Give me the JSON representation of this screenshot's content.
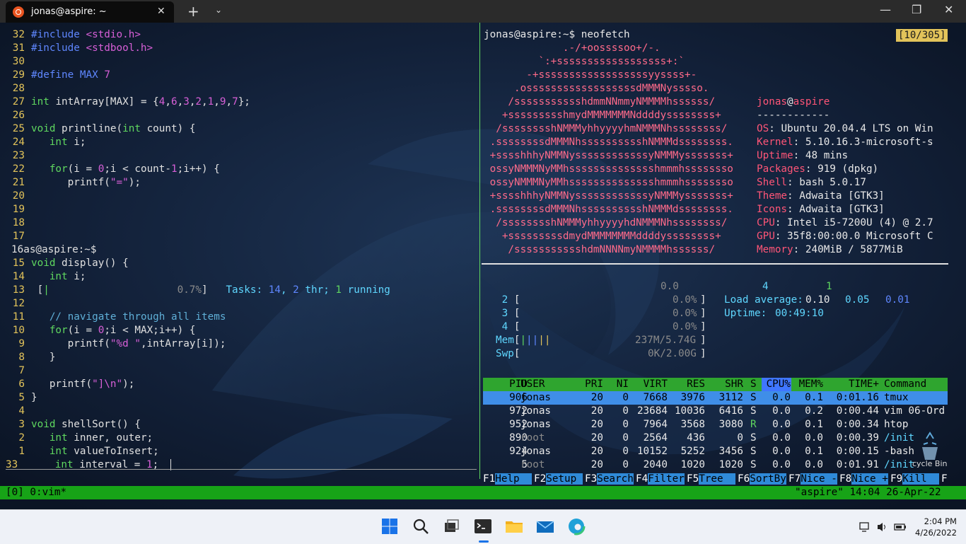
{
  "window": {
    "tab_title": "jonas@aspire: ~",
    "tab_close": "✕",
    "new_tab": "+",
    "dropdown": "⌄",
    "minimize": "—",
    "maximize": "❐",
    "close": "✕"
  },
  "vim": {
    "lines": [
      {
        "ln": "32",
        "parts": [
          [
            "pp",
            "#include "
          ],
          [
            "str",
            "<stdio.h>"
          ]
        ]
      },
      {
        "ln": "31",
        "parts": [
          [
            "pp",
            "#include "
          ],
          [
            "str",
            "<stdbool.h>"
          ]
        ]
      },
      {
        "ln": "30",
        "parts": []
      },
      {
        "ln": "29",
        "parts": [
          [
            "pp",
            "#define "
          ],
          [
            "pp",
            "MAX "
          ],
          [
            "num",
            "7"
          ]
        ]
      },
      {
        "ln": "28",
        "parts": []
      },
      {
        "ln": "27",
        "parts": [
          [
            "kw",
            "int "
          ],
          [
            "tx",
            "intArray[MAX] = {"
          ],
          [
            "num",
            "4"
          ],
          [
            "tx",
            ","
          ],
          [
            "num",
            "6"
          ],
          [
            "tx",
            ","
          ],
          [
            "num",
            "3"
          ],
          [
            "tx",
            ","
          ],
          [
            "num",
            "2"
          ],
          [
            "tx",
            ","
          ],
          [
            "num",
            "1"
          ],
          [
            "tx",
            ","
          ],
          [
            "num",
            "9"
          ],
          [
            "tx",
            ","
          ],
          [
            "num",
            "7"
          ],
          [
            "tx",
            "};"
          ]
        ]
      },
      {
        "ln": "26",
        "parts": []
      },
      {
        "ln": "25",
        "parts": [
          [
            "kw",
            "void "
          ],
          [
            "tx",
            "printline("
          ],
          [
            "kw",
            "int "
          ],
          [
            "tx",
            "count) {"
          ]
        ]
      },
      {
        "ln": "24",
        "parts": [
          [
            "tx",
            "   "
          ],
          [
            "kw",
            "int "
          ],
          [
            "tx",
            "i;"
          ]
        ]
      },
      {
        "ln": "23",
        "parts": []
      },
      {
        "ln": "22",
        "parts": [
          [
            "tx",
            "   "
          ],
          [
            "kw",
            "for"
          ],
          [
            "tx",
            "(i = "
          ],
          [
            "num",
            "0"
          ],
          [
            "tx",
            ";i < count-"
          ],
          [
            "num",
            "1"
          ],
          [
            "tx",
            ";i++) {"
          ]
        ]
      },
      {
        "ln": "21",
        "parts": [
          [
            "tx",
            "      printf("
          ],
          [
            "str",
            "\"=\""
          ],
          [
            "tx",
            ");"
          ]
        ]
      },
      {
        "ln": "20",
        "parts": []
      },
      {
        "ln": "19",
        "parts": []
      },
      {
        "ln": "18",
        "parts": []
      },
      {
        "ln": "17",
        "parts": []
      },
      {
        "ln": "16",
        "raw": "16as@aspire:~$",
        "parts": []
      },
      {
        "ln": "15",
        "parts": [
          [
            "kw",
            "void "
          ],
          [
            "tx",
            "display() {"
          ]
        ]
      },
      {
        "ln": "14",
        "parts": [
          [
            "tx",
            "   "
          ],
          [
            "kw",
            "int "
          ],
          [
            "tx",
            "i;"
          ]
        ]
      },
      {
        "ln": "13",
        "parts": [
          [
            "tx",
            " ["
          ],
          [
            "gr",
            "|"
          ],
          [
            "gy",
            "                     0.7%"
          ],
          [
            "tx",
            "]   "
          ],
          [
            "cy",
            "Tasks: "
          ],
          [
            "bl",
            "14"
          ],
          [
            "cy",
            ", "
          ],
          [
            "bl",
            "2 "
          ],
          [
            "cy",
            "thr; "
          ],
          [
            "gr",
            "1 "
          ],
          [
            "cy",
            "running"
          ]
        ]
      },
      {
        "ln": "12",
        "parts": []
      },
      {
        "ln": "11",
        "parts": [
          [
            "tx",
            "   "
          ],
          [
            "cm",
            "// navigate through all items"
          ]
        ]
      },
      {
        "ln": "10",
        "parts": [
          [
            "tx",
            "   "
          ],
          [
            "kw",
            "for"
          ],
          [
            "tx",
            "(i = "
          ],
          [
            "num",
            "0"
          ],
          [
            "tx",
            ";i < MAX;i++) {"
          ]
        ]
      },
      {
        "ln": "9",
        "parts": [
          [
            "tx",
            "      printf("
          ],
          [
            "str",
            "\"%d \""
          ],
          [
            "tx",
            ",intArray[i]);"
          ]
        ]
      },
      {
        "ln": "8",
        "parts": [
          [
            "tx",
            "   }"
          ]
        ]
      },
      {
        "ln": "7",
        "parts": []
      },
      {
        "ln": "6",
        "parts": [
          [
            "tx",
            "   printf("
          ],
          [
            "str",
            "\"]\\n\""
          ],
          [
            "tx",
            ");"
          ]
        ]
      },
      {
        "ln": "5",
        "parts": [
          [
            "tx",
            "}"
          ]
        ]
      },
      {
        "ln": "4",
        "parts": []
      },
      {
        "ln": "3",
        "parts": [
          [
            "kw",
            "void "
          ],
          [
            "tx",
            "shellSort() {"
          ]
        ]
      },
      {
        "ln": "2",
        "parts": [
          [
            "tx",
            "   "
          ],
          [
            "kw",
            "int "
          ],
          [
            "tx",
            "inner, outer;"
          ]
        ]
      },
      {
        "ln": "1",
        "parts": [
          [
            "tx",
            "   "
          ],
          [
            "kw",
            "int "
          ],
          [
            "tx",
            "valueToInsert;"
          ]
        ]
      },
      {
        "ln": "33",
        "cur": true,
        "parts": [
          [
            "tx",
            "   "
          ],
          [
            "kw",
            "int "
          ],
          [
            "tx",
            "interval = "
          ],
          [
            "num",
            "1"
          ],
          [
            "tx",
            ";  "
          ]
        ]
      }
    ]
  },
  "neofetch": {
    "prompt": "jonas@aspire:~$ neofetch",
    "counter": "[10/305]",
    "logo": [
      "             .-/+oossssoo+/-.",
      "         `:+ssssssssssssssssss+:`",
      "       -+ssssssssssssssssssyyssss+-",
      "     .ossssssssssssssssssdMMMNysssso.",
      "    /ssssssssssshdmmNNmmyNMMMMhssssss/",
      "   +ssssssssshmydMMMMMMMNddddyssssssss+",
      "  /sssssssshNMMMyhhyyyyhmNMMMNhssssssss/",
      " .ssssssssdMMMNhsssssssssshNMMMdssssssss.",
      " +sssshhhyNMMNyssssssssssssyNMMMysssssss+",
      " ossyNMMMNyMMhsssssssssssssshmmmhssssssso",
      " ossyNMMMNyMMhsssssssssssssshmmmhssssssso",
      " +sssshhhyNMMNyssssssssssssyNMMMysssssss+",
      " .ssssssssdMMMNhsssssssssshNMMMdssssssss.",
      "  /sssssssshNMMMyhhyyyyhdNMMMNhssssssss/",
      "   +sssssssssdmydMMMMMMMMddddyssssssss+",
      "    /ssssssssssshdmNNNNmyNMMMMhssssss/"
    ],
    "user": "jonas",
    "at": "@",
    "host": "aspire",
    "sep": "------------",
    "info": [
      {
        "key": "OS",
        "value": "Ubuntu 20.04.4 LTS on Win"
      },
      {
        "key": "Kernel",
        "value": "5.10.16.3-microsoft-s"
      },
      {
        "key": "Uptime",
        "value": "48 mins"
      },
      {
        "key": "Packages",
        "value": "919 (dpkg)"
      },
      {
        "key": "Shell",
        "value": "bash 5.0.17"
      },
      {
        "key": "Theme",
        "value": "Adwaita [GTK3]"
      },
      {
        "key": "Icons",
        "value": "Adwaita [GTK3]"
      },
      {
        "key": "CPU",
        "value": "Intel i5-7200U (4) @ 2.7"
      },
      {
        "key": "GPU",
        "value": "35f8:00:00.0 Microsoft C"
      },
      {
        "key": "Memory",
        "value": "240MiB / 5877MiB"
      }
    ]
  },
  "htop": {
    "top_line": {
      "val": "0.0",
      "n1": "4",
      "n2": "1"
    },
    "cpus": [
      {
        "n": "2",
        "pct": "0.0%"
      },
      {
        "n": "3",
        "pct": "0.0%"
      },
      {
        "n": "4",
        "pct": "0.0%"
      }
    ],
    "load_label": "Load average: ",
    "load": [
      "0.10",
      "0.05",
      "0.01"
    ],
    "uptime_label": "Uptime: ",
    "uptime": "00:49:10",
    "mem_label": "Mem",
    "mem": "237M/5.74G",
    "swp_label": "Swp",
    "swp": "0K/2.00G",
    "columns": [
      "PID",
      "USER",
      "PRI",
      "NI",
      "VIRT",
      "RES",
      "SHR",
      "S",
      "CPU%",
      "MEM%",
      "TIME+",
      "Command"
    ],
    "rows": [
      {
        "pid": "906",
        "user": "jonas",
        "pri": "20",
        "ni": "0",
        "virt": "7668",
        "res": "3976",
        "shr": "3112",
        "s": "S",
        "cpu": "0.0",
        "mem": "0.1",
        "time": "0:01.16",
        "cmd": "tmux"
      },
      {
        "pid": "972",
        "user": "jonas",
        "pri": "20",
        "ni": "0",
        "virt": "23684",
        "res": "10036",
        "shr": "6416",
        "s": "S",
        "cpu": "0.0",
        "mem": "0.2",
        "time": "0:00.44",
        "cmd": "vim 06-Ord"
      },
      {
        "pid": "952",
        "user": "jonas",
        "pri": "20",
        "ni": "0",
        "virt": "7964",
        "res": "3568",
        "shr": "3080",
        "s": "R",
        "cpu": "0.0",
        "mem": "0.1",
        "time": "0:00.34",
        "cmd": "htop"
      },
      {
        "pid": "890",
        "user": "root",
        "pri": "20",
        "ni": "0",
        "virt": "2564",
        "res": "436",
        "shr": "0",
        "s": "S",
        "cpu": "0.0",
        "mem": "0.0",
        "time": "0:00.39",
        "cmd": "/init"
      },
      {
        "pid": "924",
        "user": "jonas",
        "pri": "20",
        "ni": "0",
        "virt": "10152",
        "res": "5252",
        "shr": "3456",
        "s": "S",
        "cpu": "0.0",
        "mem": "0.1",
        "time": "0:00.15",
        "cmd": "-bash"
      },
      {
        "pid": "5",
        "user": "root",
        "pri": "20",
        "ni": "0",
        "virt": "2040",
        "res": "1020",
        "shr": "1020",
        "s": "S",
        "cpu": "0.0",
        "mem": "0.0",
        "time": "0:01.91",
        "cmd": "/init"
      }
    ],
    "fkeys": [
      {
        "k": "F1",
        "label": "Help  "
      },
      {
        "k": "F2",
        "label": "Setup "
      },
      {
        "k": "F3",
        "label": "Search"
      },
      {
        "k": "F4",
        "label": "Filter"
      },
      {
        "k": "F5",
        "label": "Tree  "
      },
      {
        "k": "F6",
        "label": "SortBy"
      },
      {
        "k": "F7",
        "label": "Nice -"
      },
      {
        "k": "F8",
        "label": "Nice +"
      },
      {
        "k": "F9",
        "label": "Kill  "
      },
      {
        "k": "F",
        "label": ""
      }
    ]
  },
  "tmux": {
    "left": "[0] 0:vim*",
    "right": "\"aspire\" 14:04 26-Apr-22"
  },
  "desktop": {
    "recycle_label": "cycle Bin"
  },
  "taskbar": {
    "time": "2:04 PM",
    "date": "4/26/2022",
    "icons": [
      "start-icon",
      "search-icon",
      "task-view-icon",
      "terminal-icon",
      "file-explorer-icon",
      "mail-icon",
      "edge-icon"
    ]
  },
  "colors": {
    "tmux_status": "#17a317",
    "htop_header": "#2fa52f",
    "htop_selected": "#3f8ee8",
    "ubuntu_orange": "#e95420"
  }
}
